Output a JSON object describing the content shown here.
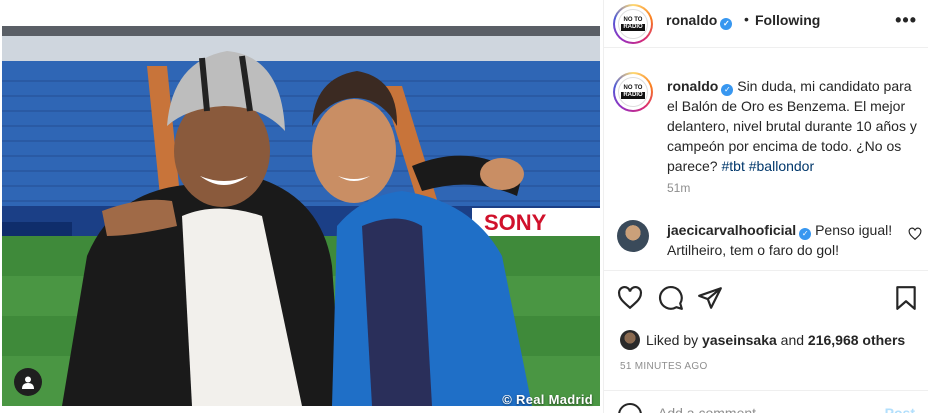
{
  "post": {
    "watermark": "© Real Madrid"
  },
  "header": {
    "avatar_logo_top": "NO TO",
    "avatar_logo_bottom": "RADIO",
    "username": "ronaldo",
    "dot": "•",
    "follow_status": "Following",
    "more": "•••"
  },
  "caption": {
    "username": "ronaldo",
    "text": " Sin duda, mi candidato para el Balón de Oro es Benzema. El mejor delantero, nivel brutal durante 10 años y campeón por encima de todo. ¿No os parece? ",
    "hashtag1": "#tbt",
    "hashtag2": "#ballondor",
    "time": "51m"
  },
  "comments": [
    {
      "username": "jaecicarvalhooficial",
      "text": " Penso igual! Artilheiro, tem o faro do gol!"
    }
  ],
  "likes": {
    "prefix": "Liked by ",
    "user": "yaseinsaka",
    "middle": " and ",
    "count": "216,968 others"
  },
  "post_time": "51 MINUTES AGO",
  "add_comment": {
    "placeholder": "Add a comment…",
    "post": "Post"
  },
  "colors": {
    "verified": "#3897f0",
    "hashtag": "#00376b",
    "muted": "#8e8e8e"
  },
  "icons": [
    "user-tag-icon",
    "verified-icon",
    "more-icon",
    "heart-icon",
    "comment-icon",
    "share-icon",
    "bookmark-icon",
    "emoji-icon"
  ]
}
